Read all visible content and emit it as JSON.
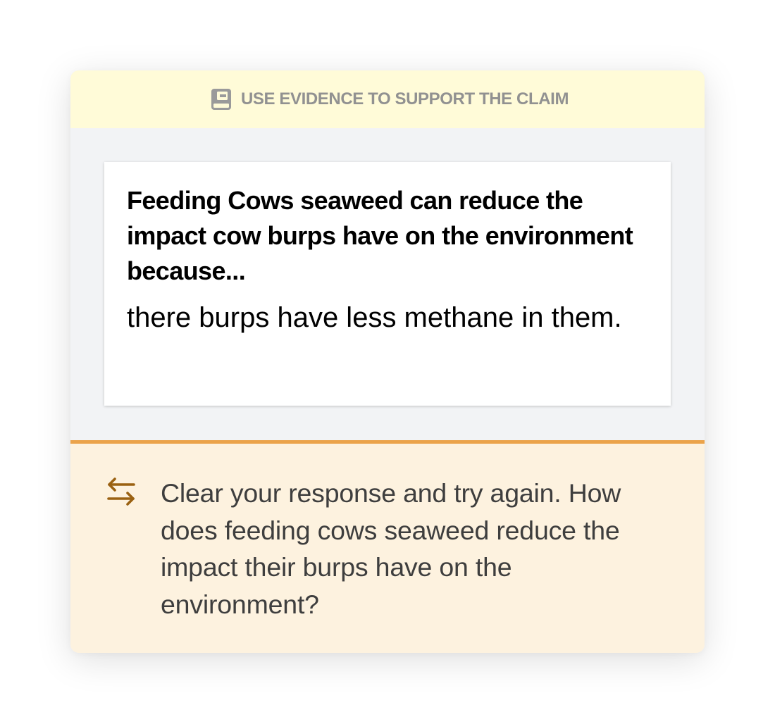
{
  "banner": {
    "icon": "book-icon",
    "label": "USE EVIDENCE TO SUPPORT THE CLAIM"
  },
  "response": {
    "prompt": "Feeding Cows seaweed can reduce the impact cow burps have on the environment because...",
    "answer": "there burps have less methane in them."
  },
  "feedback": {
    "icon": "swap-arrows-icon",
    "message": "Clear your response and try again. How does feeding cows seaweed reduce the impact their burps have on the environment?"
  },
  "colors": {
    "banner_bg": "#fffbd8",
    "feedback_bg": "#fdf2df",
    "feedback_border": "#eba34a",
    "feedback_icon": "#9a6111",
    "work_area_bg": "#f2f3f5"
  }
}
